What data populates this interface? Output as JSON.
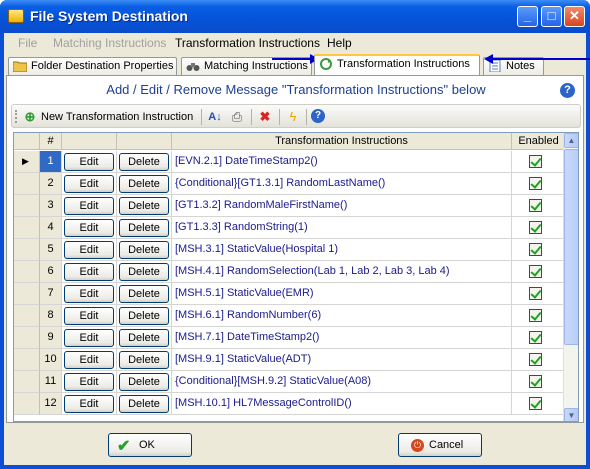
{
  "window": {
    "title": "File System Destination"
  },
  "menu": [
    {
      "label": "File",
      "disabled": true
    },
    {
      "label": "Matching Instructions",
      "disabled": true
    },
    {
      "label": "Transformation Instructions",
      "disabled": false
    },
    {
      "label": "Help",
      "disabled": false
    }
  ],
  "tabs": [
    {
      "label": "Folder Destination Properties",
      "icon": "folder-icon"
    },
    {
      "label": "Matching Instructions",
      "icon": "binoculars-icon"
    },
    {
      "label": "Transformation Instructions",
      "icon": "transform-icon",
      "active": true
    },
    {
      "label": "Notes",
      "icon": "notes-icon"
    }
  ],
  "panel": {
    "heading": "Add / Edit / Remove Message \"Transformation Instructions\" below"
  },
  "toolbar": {
    "new_label": "New Transformation Instruction"
  },
  "grid": {
    "columns": [
      "#",
      "Transformation Instructions",
      "Enabled"
    ],
    "edit_label": "Edit",
    "delete_label": "Delete",
    "rows": [
      {
        "num": "1",
        "text": "[EVN.2.1] DateTimeStamp2()",
        "enabled": true
      },
      {
        "num": "2",
        "text": "{Conditional}[GT1.3.1] RandomLastName()",
        "enabled": true
      },
      {
        "num": "3",
        "text": "[GT1.3.2] RandomMaleFirstName()",
        "enabled": true
      },
      {
        "num": "4",
        "text": "[GT1.3.3] RandomString(1)",
        "enabled": true
      },
      {
        "num": "5",
        "text": "[MSH.3.1] StaticValue(Hospital 1)",
        "enabled": true
      },
      {
        "num": "6",
        "text": "[MSH.4.1] RandomSelection(Lab 1, Lab 2, Lab 3, Lab 4)",
        "enabled": true
      },
      {
        "num": "7",
        "text": "[MSH.5.1] StaticValue(EMR)",
        "enabled": true
      },
      {
        "num": "8",
        "text": "[MSH.6.1] RandomNumber(6)",
        "enabled": true
      },
      {
        "num": "9",
        "text": "[MSH.7.1] DateTimeStamp2()",
        "enabled": true
      },
      {
        "num": "10",
        "text": "[MSH.9.1] StaticValue(ADT)",
        "enabled": true
      },
      {
        "num": "11",
        "text": "{Conditional}[MSH.9.2] StaticValue(A08)",
        "enabled": true
      },
      {
        "num": "12",
        "text": "[MSH.10.1] HL7MessageControlID()",
        "enabled": true
      }
    ]
  },
  "footer": {
    "ok_label": "OK",
    "cancel_label": "Cancel"
  }
}
